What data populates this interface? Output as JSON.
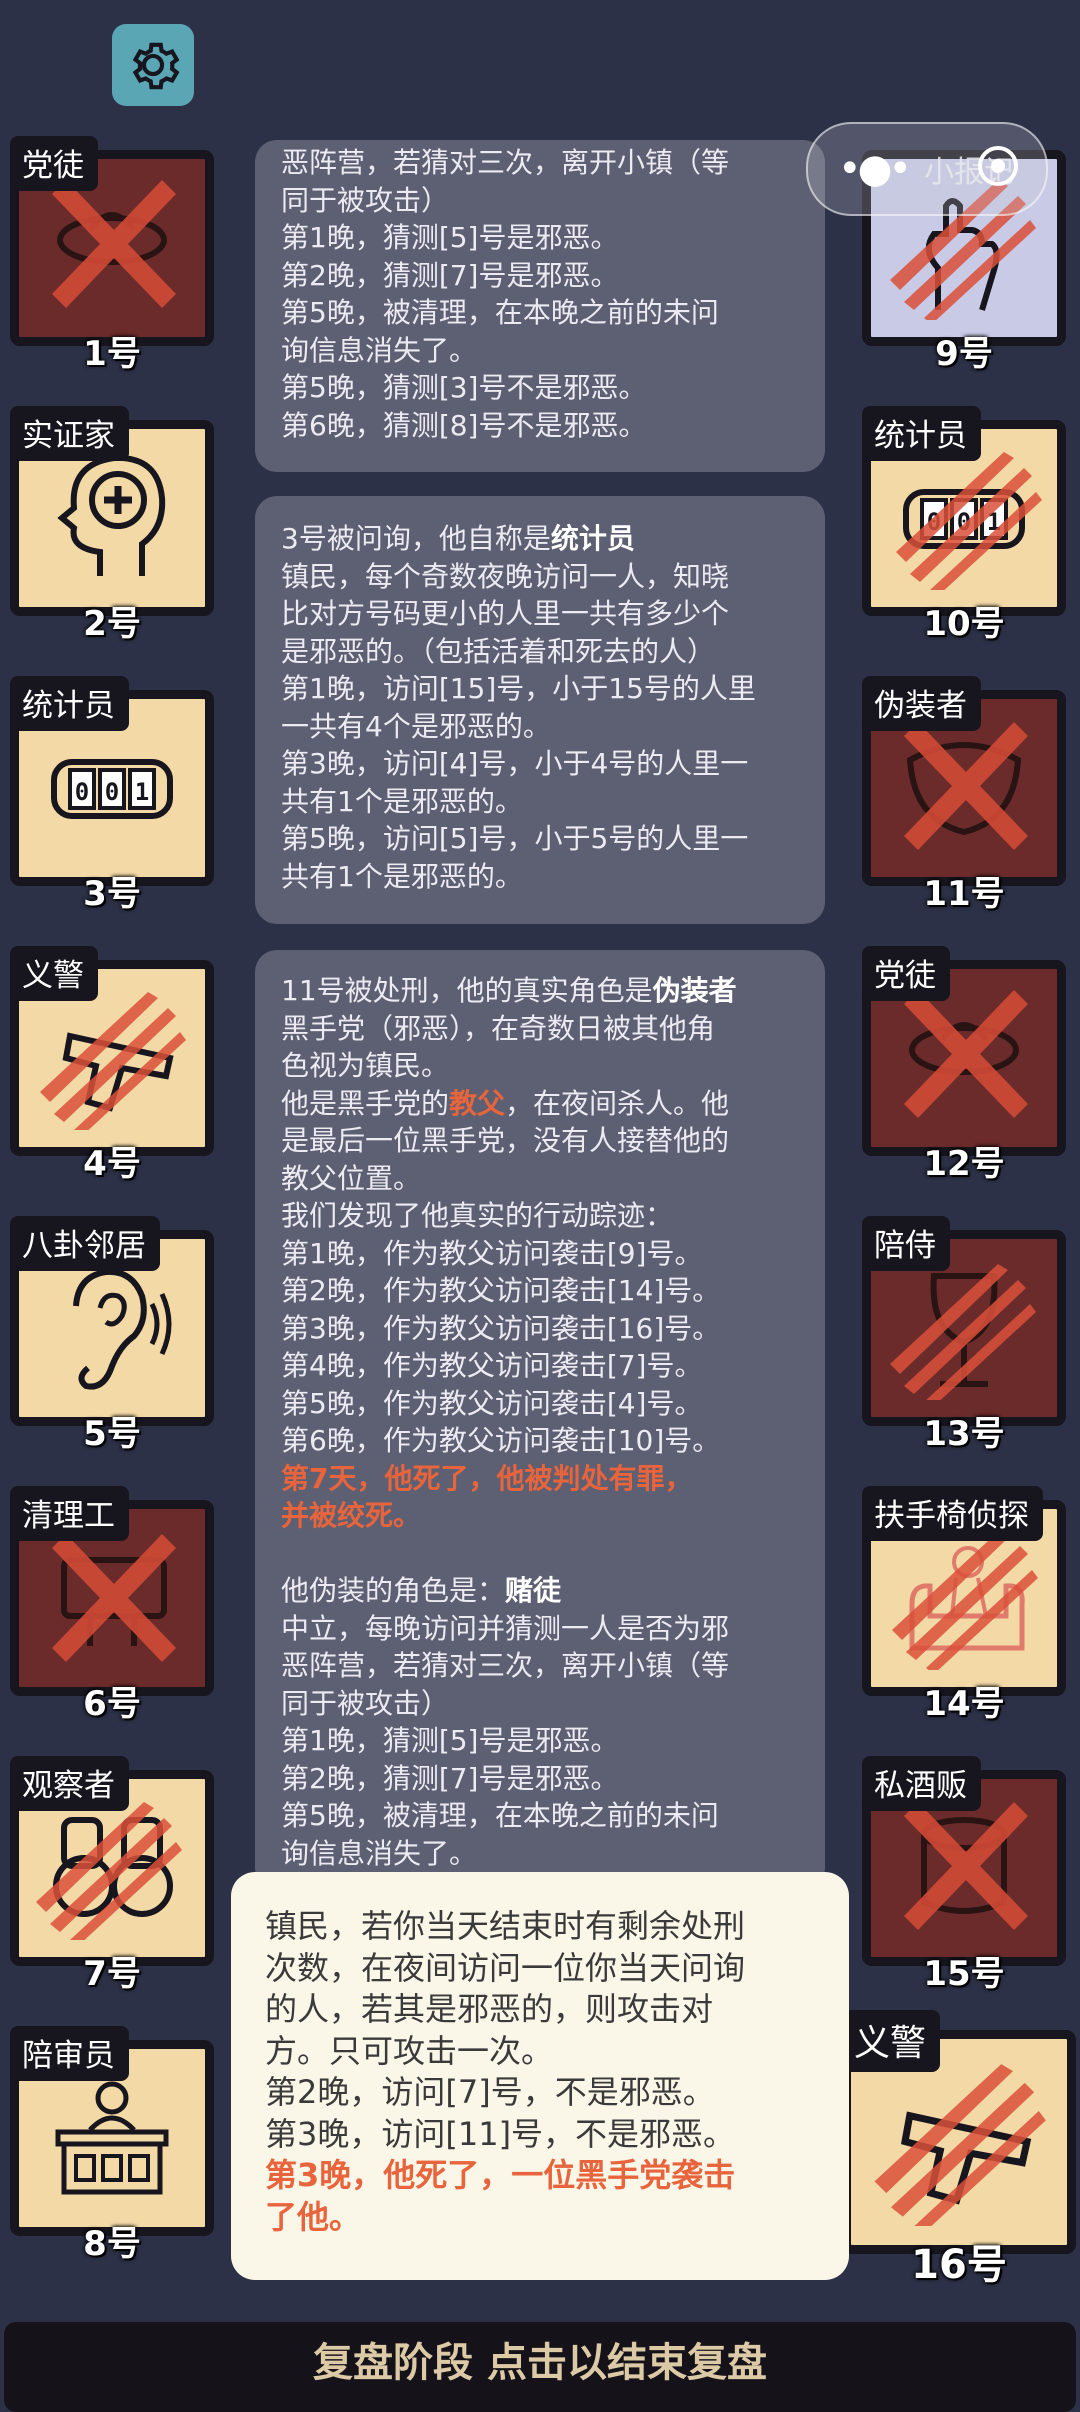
{
  "top_bar": {
    "settings_icon": "gear-icon",
    "mini_label": "小报记"
  },
  "players": [
    {
      "num": "1号",
      "role": "党徒",
      "status": "dead",
      "icon": "ornament-icon"
    },
    {
      "num": "2号",
      "role": "实证家",
      "status": "alive",
      "icon": "head-plus-icon"
    },
    {
      "num": "3号",
      "role": "统计员",
      "status": "alive",
      "icon": "counter-icon"
    },
    {
      "num": "4号",
      "role": "义警",
      "status": "attacked",
      "icon": "gun-icon"
    },
    {
      "num": "5号",
      "role": "八卦邻居",
      "status": "alive",
      "icon": "ear-icon"
    },
    {
      "num": "6号",
      "role": "清理工",
      "status": "dead",
      "icon": "car-icon"
    },
    {
      "num": "7号",
      "role": "观察者",
      "status": "attacked",
      "icon": "binoculars-icon"
    },
    {
      "num": "8号",
      "role": "陪审员",
      "status": "alive",
      "icon": "judge-icon"
    },
    {
      "num": "9号",
      "role": "",
      "status": "attacked",
      "icon": "hand-icon"
    },
    {
      "num": "10号",
      "role": "统计员",
      "status": "attacked",
      "icon": "counter-icon"
    },
    {
      "num": "11号",
      "role": "伪装者",
      "status": "dead",
      "icon": "mask-icon"
    },
    {
      "num": "12号",
      "role": "党徒",
      "status": "dead",
      "icon": "ornament-icon"
    },
    {
      "num": "13号",
      "role": "陪侍",
      "status": "attacked",
      "icon": "wineglass-icon"
    },
    {
      "num": "14号",
      "role": "扶手椅侦探",
      "status": "attacked",
      "icon": "armchair-icon"
    },
    {
      "num": "15号",
      "role": "私酒贩",
      "status": "dead",
      "icon": "barrel-icon"
    },
    {
      "num": "16号",
      "role": "义警",
      "status": "attacked",
      "icon": "gun-icon"
    }
  ],
  "messages": {
    "box1": [
      "恶阵营，若猜对三次，离开小镇（等",
      "同于被攻击）",
      "第1晚，猜测[5]号是邪恶。",
      "第2晚，猜测[7]号是邪恶。",
      "第5晚，被清理，在本晚之前的未问",
      "询信息消失了。",
      "第5晚，猜测[3]号不是邪恶。",
      "第6晚，猜测[8]号不是邪恶。"
    ],
    "box2": {
      "intro": "3号被问询，他自称是",
      "claimed_role": "统计员",
      "lines": [
        "镇民，每个奇数夜晚访问一人，知晓",
        "比对方号码更小的人里一共有多少个",
        "是邪恶的。（包括活着和死去的人）",
        "第1晚，访问[15]号，小于15号的人里",
        "一共有4个是邪恶的。",
        "第3晚，访问[4]号，小于4号的人里一",
        "共有1个是邪恶的。",
        "第5晚，访问[5]号，小于5号的人里一",
        "共有1个是邪恶的。"
      ]
    },
    "box3": {
      "intro": "11号被处刑，他的真实角色是",
      "true_role": "伪装者",
      "l1": "黑手党（邪恶），在奇数日被其他角",
      "l2": "色视为镇民。",
      "l3a": "他是黑手党的",
      "l3b": "教父",
      "l3c": "，在夜间杀人。他",
      "l4": "是最后一位黑手党，没有人接替他的",
      "l5": "教父位置。",
      "l6": "我们发现了他真实的行动踪迹：",
      "tracks": [
        "第1晚，作为教父访问袭击[9]号。",
        "第2晚，作为教父访问袭击[14]号。",
        "第3晚，作为教父访问袭击[16]号。",
        "第4晚，作为教父访问袭击[7]号。",
        "第5晚，作为教父访问袭击[4]号。",
        "第6晚，作为教父访问袭击[10]号。"
      ],
      "death1": "第7天，他死了，他被判处有罪，",
      "death2": "并被绞死。",
      "fake_intro": "他伪装的角色是：",
      "fake_role": "赌徒",
      "fake_lines": [
        "中立，每晚访问并猜测一人是否为邪",
        "恶阵营，若猜对三次，离开小镇（等",
        "同于被攻击）",
        "第1晚，猜测[5]号是邪恶。",
        "第2晚，猜测[7]号是邪恶。",
        "第5晚，被清理，在本晚之前的未问",
        "询信息消失了。"
      ]
    }
  },
  "popup": {
    "lines": [
      "镇民，若你当天结束时有剩余处刑",
      "次数，在夜间访问一位你当天问询",
      "的人，若其是邪恶的，则攻击对",
      "方。只可攻击一次。",
      "第2晚，访问[7]号，不是邪恶。",
      "第3晚，访问[11]号，不是邪恶。"
    ],
    "death1": "第3晚，他死了，一位黑手党袭击",
    "death2": "了他。"
  },
  "bottom_bar": {
    "label": "复盘阶段 点击以结束复盘"
  },
  "colors": {
    "card_alive": "#f3d9a6",
    "card_dead": "#6b2b2b",
    "accent_red": "#e8643c",
    "background": "#2d3147"
  }
}
